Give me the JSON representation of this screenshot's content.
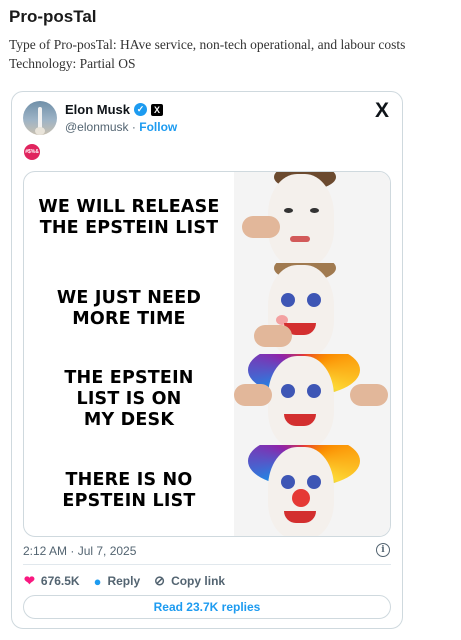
{
  "post": {
    "title": "Pro-posTal",
    "type_line": "Type of Pro-posTal: HAve service, non-tech operational, and labour costs",
    "technology_line": "Technology: Partial OS"
  },
  "tweet": {
    "author_name": "Elon Musk",
    "handle": "@elonmusk",
    "separator": "·",
    "follow_label": "Follow",
    "x_logo": "𝕏",
    "emoji_label": "#$%&",
    "meme_captions": [
      "WE WILL RELEASE\nTHE EPSTEIN LIST",
      "WE JUST NEED\nMORE TIME",
      "THE EPSTEIN\nLIST IS ON\nMY DESK",
      "THERE IS NO\nEPSTEIN LIST"
    ],
    "timestamp": "2:12 AM · Jul 7, 2025",
    "likes": "676.5K",
    "reply_label": "Reply",
    "copy_link_label": "Copy link",
    "read_replies_label": "Read 23.7K replies"
  },
  "icons": {
    "verified": "verified-badge-icon",
    "x_logo": "x-logo-icon",
    "info": "info-icon",
    "heart": "heart-icon",
    "reply": "reply-bubble-icon",
    "link": "link-icon"
  },
  "colors": {
    "link_blue": "#1d9bf0",
    "heart_pink": "#f91880",
    "muted_text": "#536471",
    "border": "#cfd9de"
  }
}
